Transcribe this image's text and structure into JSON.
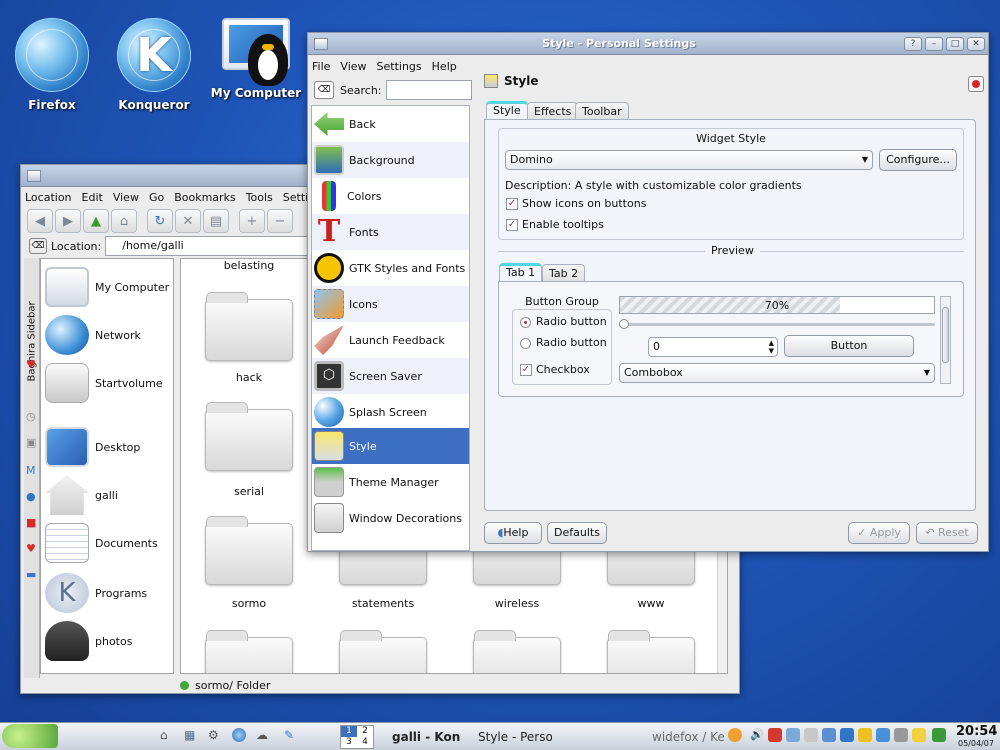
{
  "desktop_icons": [
    {
      "label": "Firefox",
      "icon": "firefox-globe-icon"
    },
    {
      "label": "Konqueror",
      "icon": "konqueror-icon"
    },
    {
      "label": "My Computer",
      "icon": "my-computer-icon"
    }
  ],
  "konqueror": {
    "menu": [
      "Location",
      "Edit",
      "View",
      "Go",
      "Bookmarks",
      "Tools",
      "Settings"
    ],
    "location_label": "Location:",
    "location_value": "/home/galli",
    "sidebar_tab_label": "Baghira Sidebar",
    "sidebar_items": [
      "My Computer",
      "Network",
      "Startvolume",
      "Desktop",
      "galli",
      "Documents",
      "Programs",
      "photos"
    ],
    "folders": [
      "belasting",
      "hack",
      "serial",
      "sormo",
      "statements",
      "wireless",
      "www"
    ],
    "status": "sormo/  Folder"
  },
  "settings": {
    "title": "Style - Personal Settings",
    "menu": [
      "File",
      "View",
      "Settings",
      "Help"
    ],
    "search_label": "Search:",
    "search_value": "",
    "nav_items": [
      "Back",
      "Background",
      "Colors",
      "Fonts",
      "GTK Styles and Fonts",
      "Icons",
      "Launch Feedback",
      "Screen Saver",
      "Splash Screen",
      "Style",
      "Theme Manager",
      "Window Decorations"
    ],
    "selected_nav": "Style",
    "page_title": "Style",
    "tabs": [
      "Style",
      "Effects",
      "Toolbar"
    ],
    "widget_style_heading": "Widget Style",
    "widget_style_value": "Domino",
    "configure_label": "Configure...",
    "description": "Description: A style with customizable color gradients",
    "show_icons_label": "Show icons on buttons",
    "show_icons_checked": true,
    "tooltips_label": "Enable tooltips",
    "tooltips_checked": true,
    "preview_heading": "Preview",
    "preview_tabs": [
      "Tab 1",
      "Tab 2"
    ],
    "button_group_label": "Button Group",
    "radio1_label": "Radio button",
    "radio2_label": "Radio button",
    "checkbox_label": "Checkbox",
    "checkbox_checked": true,
    "progress_label": "70%",
    "progress_value": 0.7,
    "spin_value": "0",
    "button_label": "Button",
    "combobox_label": "Combobox",
    "help_label": "Help",
    "defaults_label": "Defaults",
    "apply_label": "Apply",
    "reset_label": "Reset"
  },
  "taskbar": {
    "desktops": [
      "1",
      "2",
      "3",
      "4"
    ],
    "apps": [
      "galli - Konq",
      "Style - Perso",
      "widefox / Ke"
    ],
    "clock_time": "20:54",
    "clock_date": "05/04/07"
  }
}
